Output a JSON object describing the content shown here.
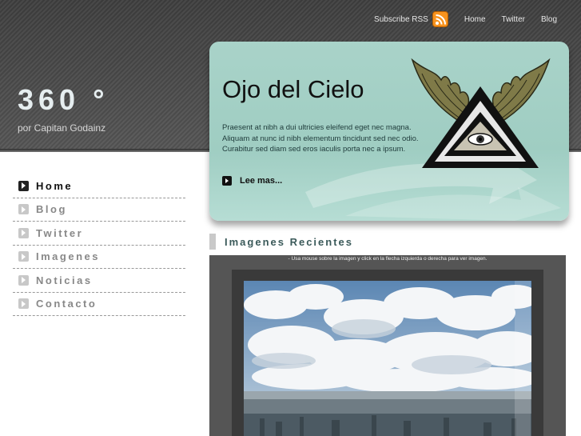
{
  "header": {
    "brand_title": "360 °",
    "brand_subtitle": "por Capitan Godainz",
    "topnav": {
      "subscribe_label": "Subscribe RSS",
      "rss_icon": "rss-feed-icon",
      "links": [
        "Home",
        "Twitter",
        "Blog"
      ]
    }
  },
  "sidebar": {
    "items": [
      {
        "label": "Home",
        "active": true
      },
      {
        "label": "Blog",
        "active": false
      },
      {
        "label": "Twitter",
        "active": false
      },
      {
        "label": "Imagenes",
        "active": false
      },
      {
        "label": "Noticias",
        "active": false
      },
      {
        "label": "Contacto",
        "active": false
      }
    ],
    "item_icon": "arrow-right-icon"
  },
  "feature": {
    "title": "Ojo del Cielo",
    "text": "Praesent at nibh a dui ultricies eleifend eget nec magna. Aliquam at nunc id nibh elementum tincidunt sed nec odio. Curabitur sed diam sed eros iaculis porta nec a ipsum.",
    "more_label": "Lee mas...",
    "emblem": "winged-eye-triangle-emblem"
  },
  "gallery": {
    "title": "Imagenes Recientes",
    "hint": "- Usa mouse sobre la imagen y click en la flecha izquierda o derecha para ver imagen.",
    "photo": "city-skyline-clouds-photo"
  },
  "colors": {
    "header_bg": "#474747",
    "feature_bg": "#a9d3c9",
    "accent_text": "#3b5a5a",
    "rss_orange": "#f7931e"
  }
}
